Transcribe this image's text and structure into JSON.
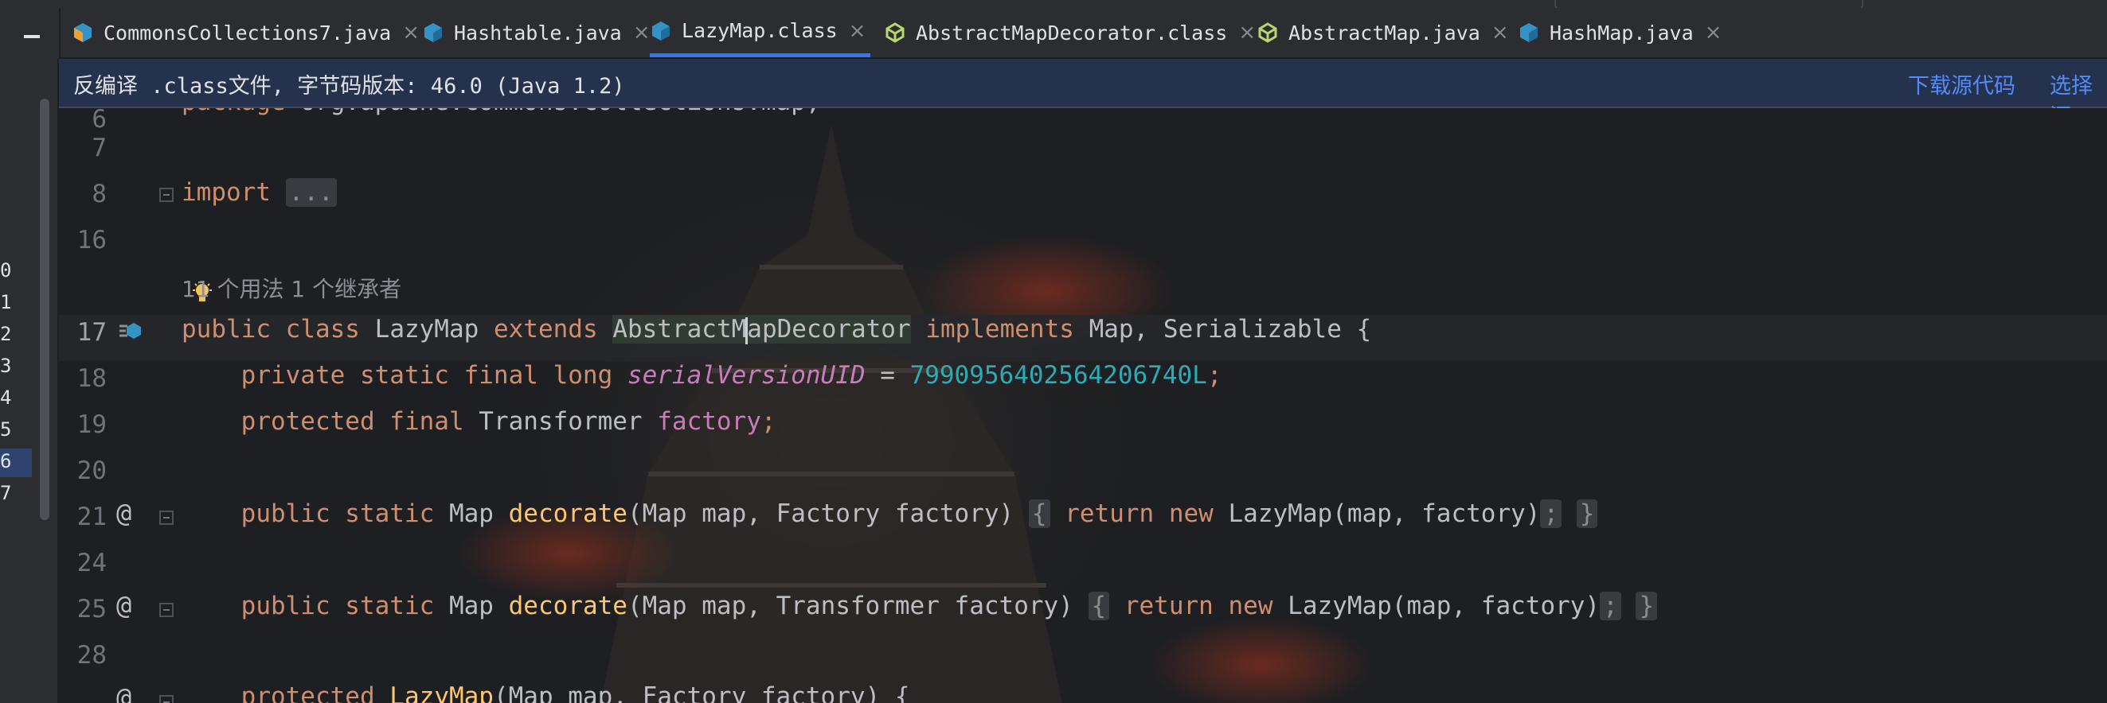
{
  "tabs": [
    {
      "label": "CommonsCollections7.java",
      "icon": "java-class-icon",
      "active": false
    },
    {
      "label": "Hashtable.java",
      "icon": "java-class-icon",
      "active": false
    },
    {
      "label": "LazyMap.class",
      "icon": "class-file-icon",
      "active": true
    },
    {
      "label": "AbstractMapDecorator.class",
      "icon": "abstract-class-icon",
      "active": false
    },
    {
      "label": "AbstractMap.java",
      "icon": "abstract-class-icon",
      "active": false
    },
    {
      "label": "HashMap.java",
      "icon": "java-class-icon",
      "active": false
    }
  ],
  "tab_close_glyph": "×",
  "banner": {
    "message": "反编译 .class文件, 字节码版本: 46.0 (Java 1.2)",
    "download_label": "下载源代码",
    "choose_label": "选择源"
  },
  "left_panel": {
    "line_numbers": [
      "0",
      "1",
      "2",
      "3",
      "4",
      "5",
      "6",
      "7"
    ]
  },
  "gutter": {
    "lines": [
      "7",
      "8",
      "16",
      "17",
      "18",
      "19",
      "20",
      "21",
      "24",
      "25",
      "28"
    ],
    "annotation_glyph": "@"
  },
  "inlay_hint": "11 个用法   1 个继承者",
  "code": {
    "package_kw": "package",
    "package_name": " org.apache.commons.collections.map;",
    "import_kw": "import",
    "import_fold": "...",
    "l17": {
      "public": "public",
      "class": "class",
      "name": "LazyMap",
      "extends": "extends",
      "parent_a": "AbstractM",
      "parent_b": "apDecorator",
      "implements": "implements",
      "ifaces": " Map, Serializable {"
    },
    "l18": {
      "mods": "private static final long",
      "field": "serialVersionUID",
      "eq": " = ",
      "value": "7990956402564206740L",
      "semi": ";"
    },
    "l19": {
      "mods": "protected final",
      "type": " Transformer ",
      "field": "factory",
      "semi": ";"
    },
    "l21": {
      "mods": "public static",
      "type": " Map ",
      "method": "decorate",
      "params": "(Map map, Factory factory) ",
      "brace_open": "{",
      "ret": "return new",
      "call": " LazyMap(map, factory)",
      "semi": ";",
      "brace_close": "}"
    },
    "l25": {
      "mods": "public static",
      "type": " Map ",
      "method": "decorate",
      "params": "(Map map, Transformer factory) ",
      "brace_open": "{",
      "ret": "return new",
      "call": " LazyMap(map, factory)",
      "semi": ";",
      "brace_close": "}"
    },
    "l29": {
      "mods": "protected",
      "name": " LazyMap",
      "params": "(Map map, Factory factory) {"
    }
  },
  "colors": {
    "keyword": "#cf8e6d",
    "method_decl": "#ffc66d",
    "field": "#c77dbb",
    "number": "#2aacb8",
    "accent": "#3574f0",
    "link": "#548af7"
  }
}
